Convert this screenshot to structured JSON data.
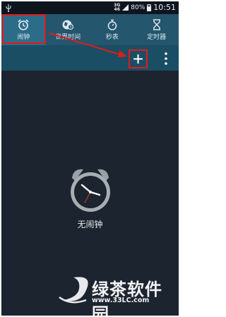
{
  "status_bar": {
    "network": "3G",
    "network_sub": "46",
    "battery": "80%",
    "time": "10:51"
  },
  "tabs": [
    {
      "label": "闹钟",
      "icon": "alarm-clock-icon",
      "active": true
    },
    {
      "label": "世界时间",
      "icon": "world-clock-icon",
      "active": false
    },
    {
      "label": "秒表",
      "icon": "stopwatch-icon",
      "active": false
    },
    {
      "label": "定时器",
      "icon": "hourglass-icon",
      "active": false
    }
  ],
  "main": {
    "empty_label": "无闹钟"
  },
  "watermark": {
    "brand": "绿茶软件园",
    "url": "www.33LC.com"
  },
  "colors": {
    "accent_highlight": "#e01b1b",
    "tab_bar": "#24566e",
    "background": "#1c2430"
  }
}
